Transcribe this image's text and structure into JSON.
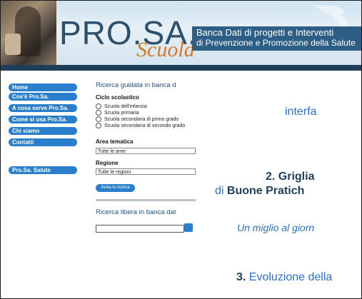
{
  "header": {
    "logo_text": "PRO.SA.",
    "logo_subtext": "Scuola",
    "banner_line1": "Banca Dati di progetti e Interventi",
    "banner_line2": "di Prevenzione e Promozione della Salute"
  },
  "nav": {
    "items": [
      {
        "label": "Home"
      },
      {
        "label": "Cos'è Pro.Sa."
      },
      {
        "label": "A cosa serve Pro.Sa."
      },
      {
        "label": "Come si usa Pro.Sa."
      },
      {
        "label": "Chi siamo"
      },
      {
        "label": "Contatti"
      }
    ],
    "extra": {
      "label": "Pro.Sa. Salute"
    }
  },
  "search": {
    "title": "Ricerca guidata in banca d",
    "ciclo_label": "Ciclo scolastico",
    "options": [
      "Scuola dell'infanzia",
      "Scuola primaria",
      "Scuola secondaria di primo grado",
      "Scuola secondaria di secondo grado"
    ],
    "area_label": "Area tematica",
    "area_value": "Tutte le aree",
    "regione_label": "Regione",
    "regione_value": "Tutte le regioni",
    "button_label": "Avvia la ricerca",
    "free_title": "Ricerca libera in banca dat"
  },
  "promo": {
    "line1": "interfa",
    "line2_num": "2. Griglia",
    "line3_di": "di ",
    "line3_bold": "Buone Pratich",
    "line4": "Un miglio al giorn",
    "line5_num": "3.",
    "line5_text": " Evoluzione della"
  },
  "colors": {
    "nav_blue": "#2a7fcc",
    "header_bar": "#1f3e59",
    "heading_blue": "#1e4e8a",
    "logo_orange": "#d6782a"
  }
}
